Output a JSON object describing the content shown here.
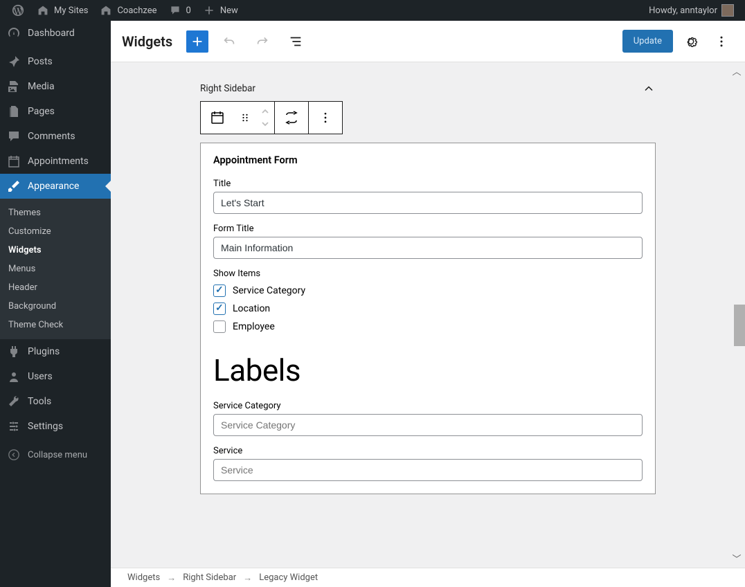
{
  "adminbar": {
    "mysites": "My Sites",
    "site": "Coachzee",
    "comments": "0",
    "new": "New",
    "howdy": "Howdy, anntaylor"
  },
  "menu": {
    "dashboard": "Dashboard",
    "posts": "Posts",
    "media": "Media",
    "pages": "Pages",
    "comments": "Comments",
    "appointments": "Appointments",
    "appearance": "Appearance",
    "plugins": "Plugins",
    "users": "Users",
    "tools": "Tools",
    "settings": "Settings",
    "collapse": "Collapse menu"
  },
  "submenu": {
    "themes": "Themes",
    "customize": "Customize",
    "widgets": "Widgets",
    "menus": "Menus",
    "header": "Header",
    "background": "Background",
    "themecheck": "Theme Check"
  },
  "editor": {
    "title": "Widgets",
    "update": "Update"
  },
  "panel": {
    "name": "Right Sidebar"
  },
  "widget": {
    "name": "Appointment Form",
    "title_label": "Title",
    "title_value": "Let's Start",
    "formtitle_label": "Form Title",
    "formtitle_value": "Main Information",
    "showitems_label": "Show Items",
    "opt_servicecategory": "Service Category",
    "opt_location": "Location",
    "opt_employee": "Employee",
    "labels_heading": "Labels",
    "lbl_servicecategory": "Service Category",
    "ph_servicecategory": "Service Category",
    "lbl_service": "Service",
    "ph_service": "Service"
  },
  "breadcrumb": {
    "a": "Widgets",
    "b": "Right Sidebar",
    "c": "Legacy Widget"
  }
}
